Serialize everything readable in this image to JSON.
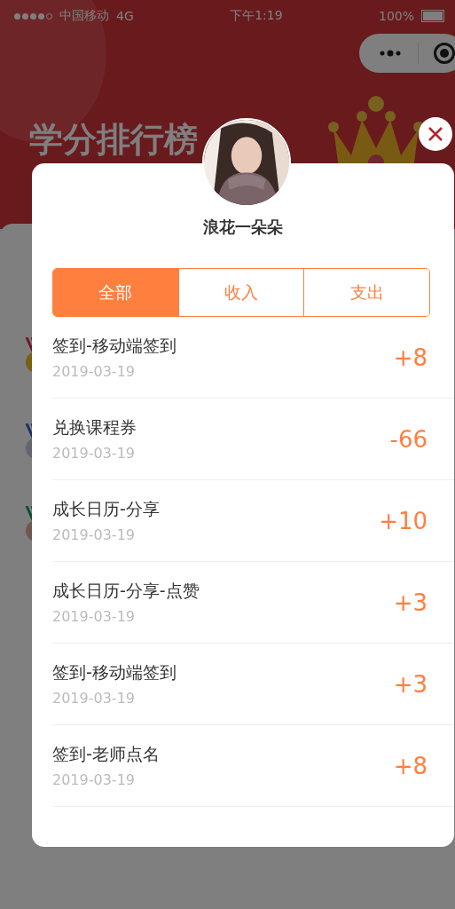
{
  "status_bar": {
    "carrier": "中国移动",
    "network": "4G",
    "time": "下午1:19",
    "battery": "100%"
  },
  "page_title": "学分排行榜",
  "dialog": {
    "user_name": "浪花一朵朵",
    "tabs": [
      {
        "label": "全部",
        "selected": true
      },
      {
        "label": "收入",
        "selected": false
      },
      {
        "label": "支出",
        "selected": false
      }
    ],
    "records": [
      {
        "title": "签到-移动端签到",
        "date": "2019-03-19",
        "points": "+8"
      },
      {
        "title": "兑换课程券",
        "date": "2019-03-19",
        "points": "-66"
      },
      {
        "title": "成长日历-分享",
        "date": "2019-03-19",
        "points": "+10"
      },
      {
        "title": "成长日历-分享-点赞",
        "date": "2019-03-19",
        "points": "+3"
      },
      {
        "title": "签到-移动端签到",
        "date": "2019-03-19",
        "points": "+3"
      },
      {
        "title": "签到-老师点名",
        "date": "2019-03-19",
        "points": "+8"
      }
    ]
  }
}
